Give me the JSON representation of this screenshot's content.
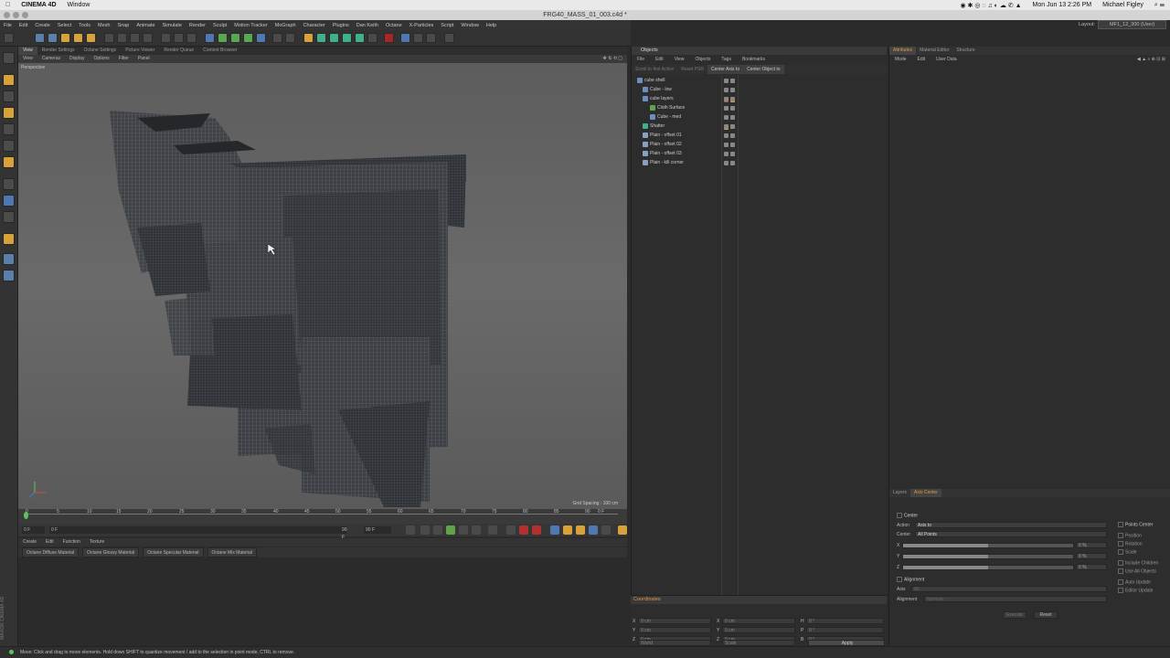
{
  "mac_menubar": {
    "app": "CINEMA 4D",
    "items": [
      "Window"
    ],
    "clock": "Mon Jun 13  2:26 PM",
    "user": "Michael Figley"
  },
  "window": {
    "title": "FRG40_MASS_01_003.c4d *"
  },
  "menus": [
    "File",
    "Edit",
    "Create",
    "Select",
    "Tools",
    "Mesh",
    "Snap",
    "Animate",
    "Simulate",
    "Render",
    "Sculpt",
    "Motion Tracker",
    "MoGraph",
    "Character",
    "Plugins",
    "Dan Keith",
    "Octane",
    "X-Particles",
    "Script",
    "Window",
    "Help"
  ],
  "layout": {
    "label": "Layout:",
    "value": "MF1_12_300 (User)"
  },
  "viewport_tabs": [
    "View",
    "Render Settings",
    "Octane Settings",
    "Picture Viewer",
    "Render Queue",
    "Content Browser"
  ],
  "viewport_menu": [
    "View",
    "Cameras",
    "Display",
    "Options",
    "Filter",
    "Panel"
  ],
  "viewport": {
    "name": "Perspective",
    "grid_spacing": "Grid Spacing : 100 cm"
  },
  "timeline": {
    "ticks": [
      "0",
      "5",
      "10",
      "15",
      "20",
      "25",
      "30",
      "35",
      "40",
      "45",
      "50",
      "55",
      "60",
      "65",
      "70",
      "75",
      "80",
      "85",
      "90"
    ],
    "frame_unit": "0 F"
  },
  "playback": {
    "start": "0 F",
    "cur": "0 F",
    "end": "90 F",
    "end2": "90 F"
  },
  "material_menu": [
    "Create",
    "Edit",
    "Function",
    "Texture"
  ],
  "materials": [
    "Octane Diffuse Material",
    "Octane Glossy Material",
    "Octane Specular Material",
    "Octane Mix Material"
  ],
  "status": "Move: Click and drag to move elements. Hold down SHIFT to quantize movement / add to the selection in point mode, CTRL to remove.",
  "objects_panel": {
    "title": "Objects",
    "menu": [
      "File",
      "Edit",
      "View",
      "Objects",
      "Tags",
      "Bookmarks"
    ],
    "tabs": [
      "Scroll to first Active",
      "Reset PSR",
      "Center Axis to",
      "Center Object to"
    ],
    "items": [
      {
        "label": "cube shell",
        "indent": 0
      },
      {
        "label": "Cube - low",
        "indent": 1
      },
      {
        "label": "cube layers",
        "indent": 1
      },
      {
        "label": "Cloth Surface",
        "indent": 2
      },
      {
        "label": "Cube - med",
        "indent": 2
      },
      {
        "label": "Shatter",
        "indent": 0
      },
      {
        "label": "Plain - offset 01",
        "indent": 0
      },
      {
        "label": "Plain - offset 02",
        "indent": 0
      },
      {
        "label": "Plain - offset 03",
        "indent": 0
      },
      {
        "label": "Plain - kill corner",
        "indent": 0
      }
    ]
  },
  "coordinates": {
    "title": "Coordinates",
    "rows": [
      {
        "a": "X",
        "av": "0 cm",
        "b": "X",
        "bv": "0 cm",
        "c": "H",
        "cv": "0 °"
      },
      {
        "a": "Y",
        "av": "0 cm",
        "b": "Y",
        "bv": "0 cm",
        "c": "P",
        "cv": "0 °"
      },
      {
        "a": "Z",
        "av": "0 cm",
        "b": "Z",
        "bv": "0 cm",
        "c": "B",
        "cv": "0 °"
      }
    ],
    "world": "World",
    "scale": "Scale",
    "apply": "Apply"
  },
  "attributes": {
    "tabs": [
      "Attributes",
      "Material Editor",
      "Structure"
    ],
    "menu": [
      "Mode",
      "Edit",
      "User Data"
    ],
    "axis_tabs": [
      "Layers",
      "Axis Center"
    ],
    "center_label": "Center",
    "action_label": "Action",
    "action_value": "Axis to",
    "center_sel_label": "Center",
    "center_sel_value": "All Points",
    "xyz": [
      {
        "axis": "X",
        "val": "0 %"
      },
      {
        "axis": "Y",
        "val": "0 %"
      },
      {
        "axis": "Z",
        "val": "0 %"
      }
    ],
    "alignment_label": "Alignment",
    "axis_label": "Axis",
    "axis_value": "All",
    "alignment2_label": "Alignment",
    "alignment2_value": "Normals",
    "checks": [
      "Points Center",
      "Position",
      "Rotation",
      "Scale",
      "Include Children",
      "Use All Objects",
      "Auto Update",
      "Editor Update"
    ],
    "execute": "Execute",
    "reset": "Reset"
  },
  "colors": {
    "accent": "#e29a3c",
    "viewport": "#636363",
    "panel": "#2d2d2d"
  }
}
